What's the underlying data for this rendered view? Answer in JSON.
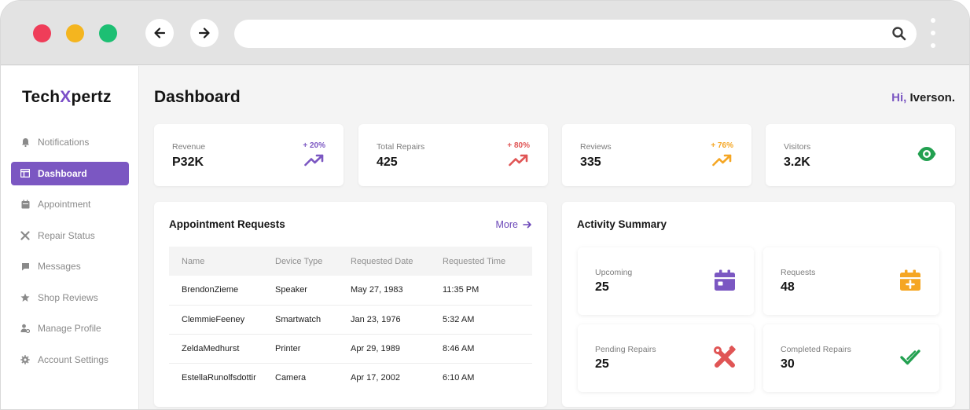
{
  "browser": {
    "url": ""
  },
  "brand": {
    "name_part1": "Tech",
    "name_x": "X",
    "name_part2": "pertz",
    "accent": "#7b57c2"
  },
  "sidebar": {
    "items": [
      {
        "label": "Notifications",
        "icon": "bell-icon"
      },
      {
        "label": "Dashboard",
        "icon": "dashboard-icon",
        "active": true
      },
      {
        "label": "Appointment",
        "icon": "calendar-icon"
      },
      {
        "label": "Repair Status",
        "icon": "tools-icon"
      },
      {
        "label": "Messages",
        "icon": "message-icon"
      },
      {
        "label": "Shop Reviews",
        "icon": "star-icon"
      },
      {
        "label": "Manage Profile",
        "icon": "user-gear-icon"
      },
      {
        "label": "Account Settings",
        "icon": "gear-icon"
      }
    ]
  },
  "header": {
    "title": "Dashboard",
    "greeting_hi": "Hi,",
    "greeting_name": " Iverson."
  },
  "stats": [
    {
      "label": "Revenue",
      "value": "P32K",
      "change": "+ 20%",
      "color": "#7b57c2"
    },
    {
      "label": "Total Repairs",
      "value": "425",
      "change": "+ 80%",
      "color": "#e05555"
    },
    {
      "label": "Reviews",
      "value": "335",
      "change": "+ 76%",
      "color": "#f5a623"
    },
    {
      "label": "Visitors",
      "value": "3.2K",
      "icon": "eye-icon",
      "color": "#22a050"
    }
  ],
  "appointments": {
    "title": "Appointment Requests",
    "more_label": "More",
    "columns": [
      "Name",
      "Device Type",
      "Requested Date",
      "Requested Time"
    ],
    "rows": [
      [
        "BrendonZieme",
        "Speaker",
        "May 27, 1983",
        "11:35 PM"
      ],
      [
        "ClemmieFeeney",
        "Smartwatch",
        "Jan 23, 1976",
        "5:32 AM"
      ],
      [
        "ZeldaMedhurst",
        "Printer",
        "Apr 29, 1989",
        "8:46 AM"
      ],
      [
        "EstellaRunolfsdottir",
        "Camera",
        "Apr 17, 2002",
        "6:10 AM"
      ]
    ]
  },
  "activity": {
    "title": "Activity Summary",
    "items": [
      {
        "label": "Upcoming",
        "value": "25",
        "icon": "calendar-icon",
        "color": "#7b57c2"
      },
      {
        "label": "Requests",
        "value": "48",
        "icon": "calendar-plus-icon",
        "color": "#f5a623"
      },
      {
        "label": "Pending Repairs",
        "value": "25",
        "icon": "tools-icon",
        "color": "#e05555"
      },
      {
        "label": "Completed Repairs",
        "value": "30",
        "icon": "checkmark-icon",
        "color": "#22a050"
      }
    ]
  }
}
